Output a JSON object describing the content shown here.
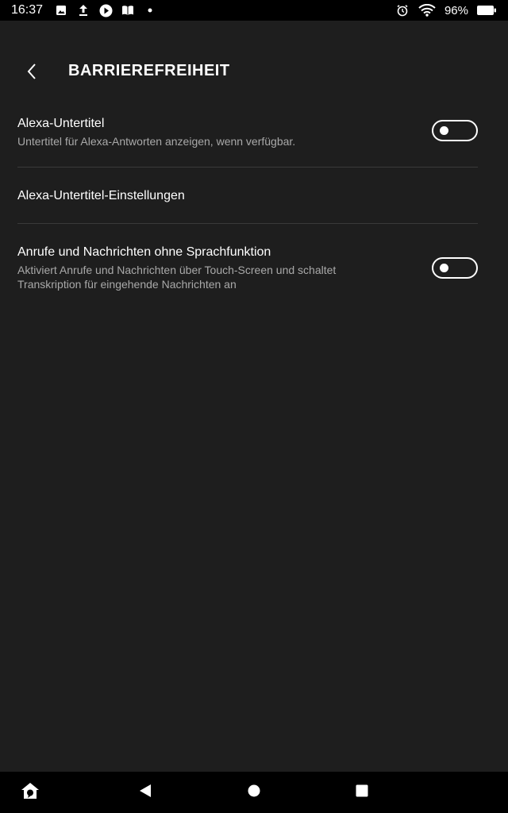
{
  "status_bar": {
    "time": "16:37",
    "battery": "96%",
    "left_icons": [
      "photo-icon",
      "upload-icon",
      "play-icon",
      "book-icon",
      "dot-icon"
    ],
    "right_icons": [
      "alarm-icon",
      "wifi-icon",
      "battery-icon"
    ]
  },
  "header": {
    "title": "BARRIEREFREIHEIT",
    "back_icon": "chevron-left-icon"
  },
  "settings": [
    {
      "title": "Alexa-Untertitel",
      "description": "Untertitel für Alexa-Antworten anzeigen, wenn verfügbar.",
      "toggle": "off"
    },
    {
      "title": "Alexa-Untertitel-Einstellungen"
    },
    {
      "title": "Anrufe und Nachrichten ohne Sprachfunktion",
      "description_line1": "Aktiviert Anrufe und Nachrichten über Touch-Screen und schaltet",
      "description_line2": "Transkription für eingehende Nachrichten an",
      "toggle": "off"
    }
  ],
  "nav_bar": {
    "icons": [
      "alexa-home-icon",
      "back-triangle-icon",
      "home-circle-icon",
      "recents-square-icon"
    ]
  },
  "colors": {
    "background": "#1e1e1e",
    "bars": "#000000",
    "text_primary": "#ffffff",
    "text_secondary": "#a9a9a9",
    "divider": "#3a3a3a"
  }
}
